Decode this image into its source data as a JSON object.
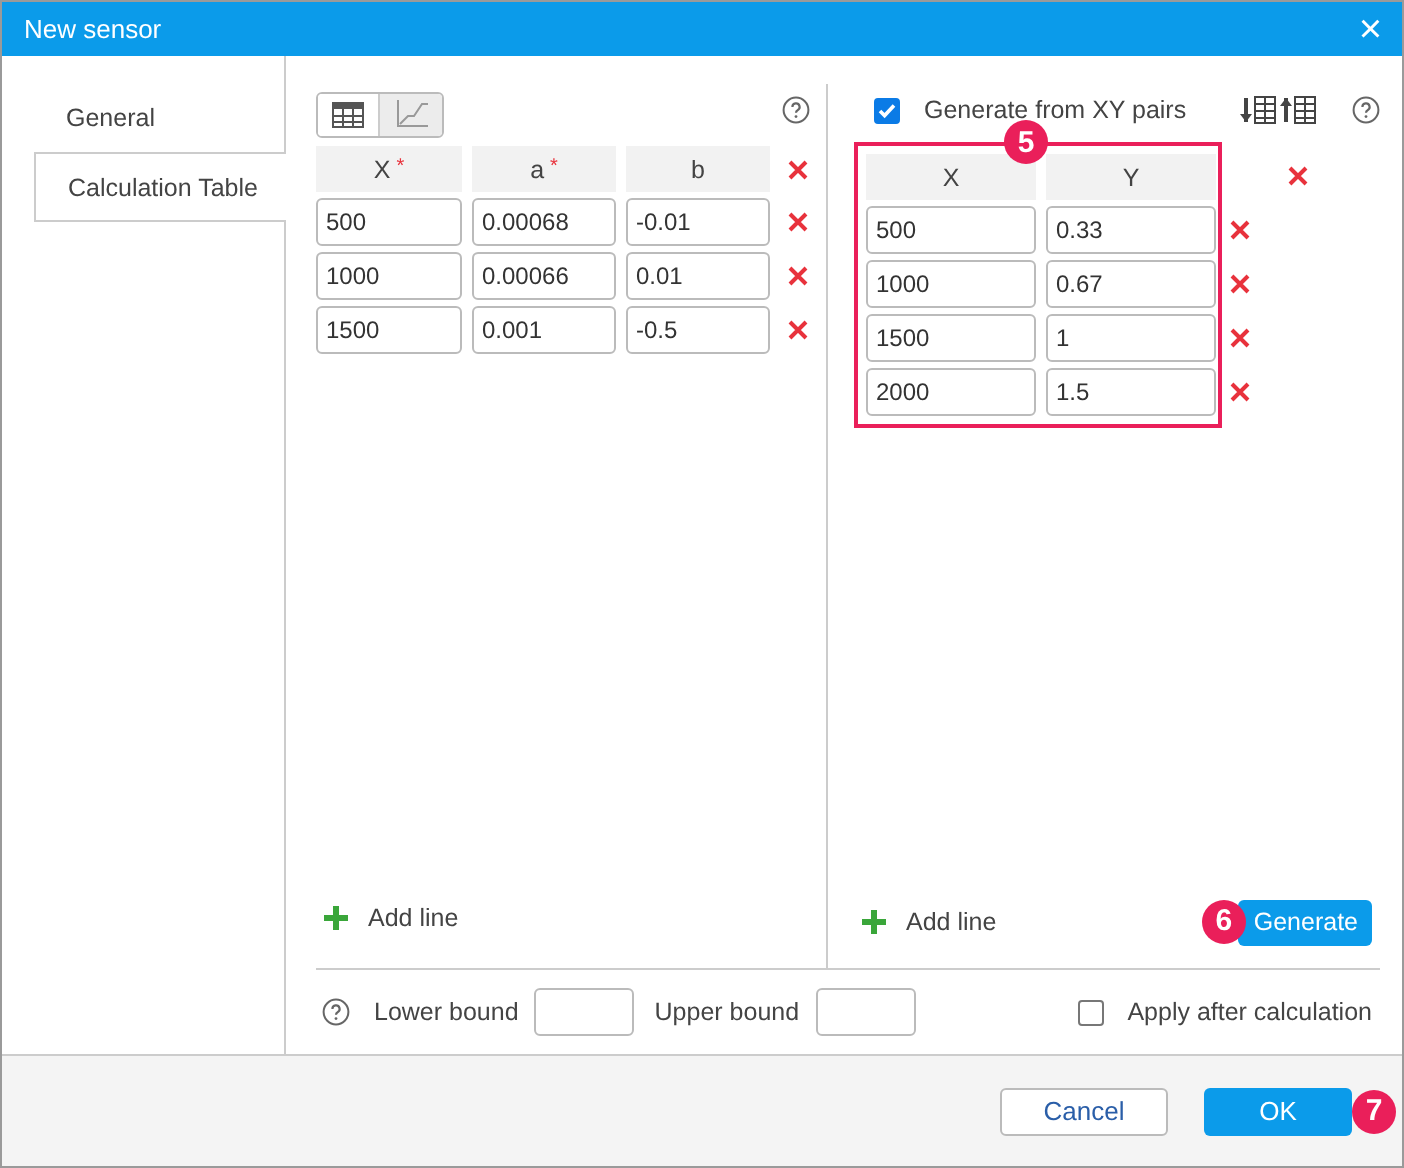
{
  "window": {
    "title": "New sensor",
    "close": "×"
  },
  "tabs": [
    {
      "label": "General",
      "selected": false
    },
    {
      "label": "Calculation Table",
      "selected": true
    }
  ],
  "view_toggle": [
    {
      "kind": "table",
      "selected": true
    },
    {
      "kind": "chart",
      "selected": false
    }
  ],
  "coef_table": {
    "required_mark": "*",
    "columns": [
      {
        "label": "X",
        "required": true
      },
      {
        "label": "a",
        "required": true
      },
      {
        "label": "b",
        "required": false
      }
    ],
    "rows": [
      [
        "500",
        "0.00068",
        "-0.01"
      ],
      [
        "1000",
        "0.00066",
        "0.01"
      ],
      [
        "1500",
        "0.001",
        "-0.5"
      ]
    ],
    "add_line": "Add line"
  },
  "xy_panel": {
    "checkbox": {
      "label": "Generate from XY pairs",
      "checked": true
    },
    "highlighted": true,
    "badge": "5",
    "columns": [
      "X",
      "Y"
    ],
    "rows": [
      [
        "500",
        "0.33"
      ],
      [
        "1000",
        "0.67"
      ],
      [
        "1500",
        "1"
      ],
      [
        "2000",
        "1.5"
      ]
    ],
    "add_line": "Add line",
    "generate": {
      "label": "Generate",
      "badge": "6"
    }
  },
  "bounds": {
    "lower": "Lower bound",
    "upper": "Upper bound",
    "apply": {
      "label": "Apply after calculation",
      "checked": false
    }
  },
  "buttons": [
    {
      "kind": "secondary",
      "label": "Cancel"
    },
    {
      "kind": "primary",
      "label": "OK",
      "badge": "7"
    }
  ]
}
